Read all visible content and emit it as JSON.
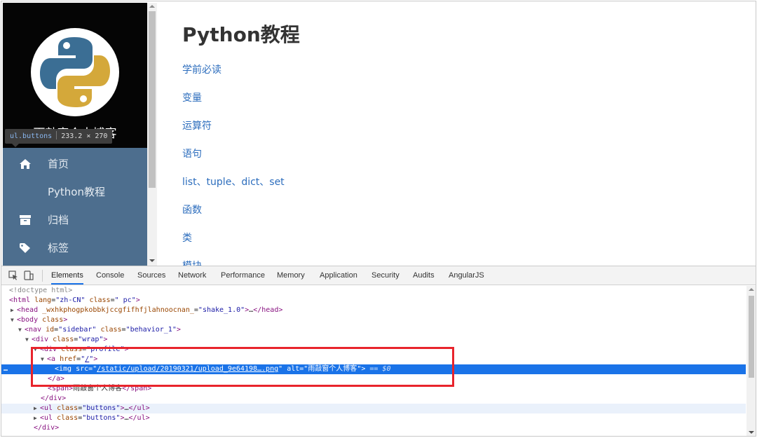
{
  "sidebar": {
    "profile_name": "雨敲窗个人博客",
    "tooltip": {
      "selector": "ul.buttons",
      "size": "233.2 × 270"
    },
    "nav_items": [
      {
        "label": "首页",
        "icon": "home-icon"
      },
      {
        "label": "Python教程",
        "icon": ""
      },
      {
        "label": "归档",
        "icon": "archive-icon"
      },
      {
        "label": "标签",
        "icon": "tag-icon"
      }
    ]
  },
  "content": {
    "title": "Python教程",
    "links": [
      "学前必读",
      "变量",
      "运算符",
      "语句",
      "list、tuple、dict、set",
      "函数",
      "类",
      "模块"
    ]
  },
  "devtools": {
    "tabs": [
      "Elements",
      "Console",
      "Sources",
      "Network",
      "Performance",
      "Memory",
      "Application",
      "Security",
      "Audits",
      "AngularJS"
    ],
    "active_tab": "Elements",
    "dom": {
      "doctype": "<!doctype html>",
      "html_lang": "zh-CN",
      "html_class": " pc",
      "head_attr": "_wxhkphogpkobbkjccgfifhfjlahnoocnan_",
      "head_attr_value": "shake_1.0",
      "nav_id": "sidebar",
      "nav_class": "behavior_1",
      "div_wrap_class": "wrap",
      "div_profile_class": "profile",
      "a_href": "/",
      "img_src": "/static/upload/20190321/upload_9e64198….png",
      "img_alt": "雨敲窗个人博客",
      "selected_ref": "== $0",
      "span_text": "雨敲窗个人博客",
      "ul_class": "buttons"
    }
  },
  "colors": {
    "sidebar_bg": "#4d6e8e",
    "link": "#2c6dbd",
    "selection": "#1a73e8",
    "highlight_box": "#e8242c"
  }
}
